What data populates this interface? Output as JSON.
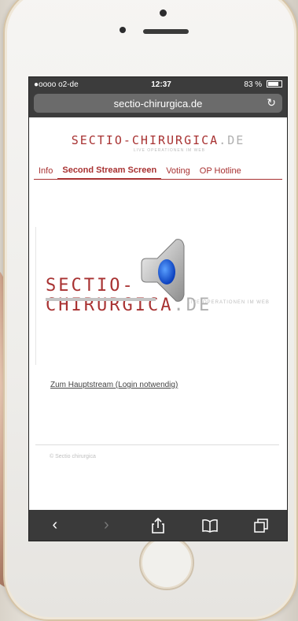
{
  "status": {
    "carrier": "●oooo o2-de",
    "time": "12:37",
    "battery": "83 %"
  },
  "browser": {
    "url": "sectio-chirurgica.de"
  },
  "site": {
    "logo_main": "SECTIO-CHIRURGICA",
    "logo_tld": ".DE",
    "logo_sub": "LIVE OPERATIONEN IM WEB"
  },
  "tabs": [
    {
      "label": "Info",
      "active": false
    },
    {
      "label": "Second Stream Screen",
      "active": true
    },
    {
      "label": "Voting",
      "active": false
    },
    {
      "label": "OP Hotline",
      "active": false
    }
  ],
  "video": {
    "logo_main": "SECTIO-CHIRURGICA",
    "logo_tld": ".DE",
    "logo_sub": "LIVE-OPERATIONEN IM WEB"
  },
  "main_link": "Zum Hauptstream (Login notwendig)",
  "copyright": "© Sectio chirurgica",
  "icons": {
    "back": "chevron-left-icon",
    "forward": "chevron-right-icon",
    "share": "share-icon",
    "bookmarks": "book-icon",
    "tabs": "tabs-icon",
    "audio": "speaker-icon"
  },
  "colors": {
    "brand": "#a83232",
    "statusbar": "#3c3c3c",
    "toolbar": "#3a3a3a"
  }
}
